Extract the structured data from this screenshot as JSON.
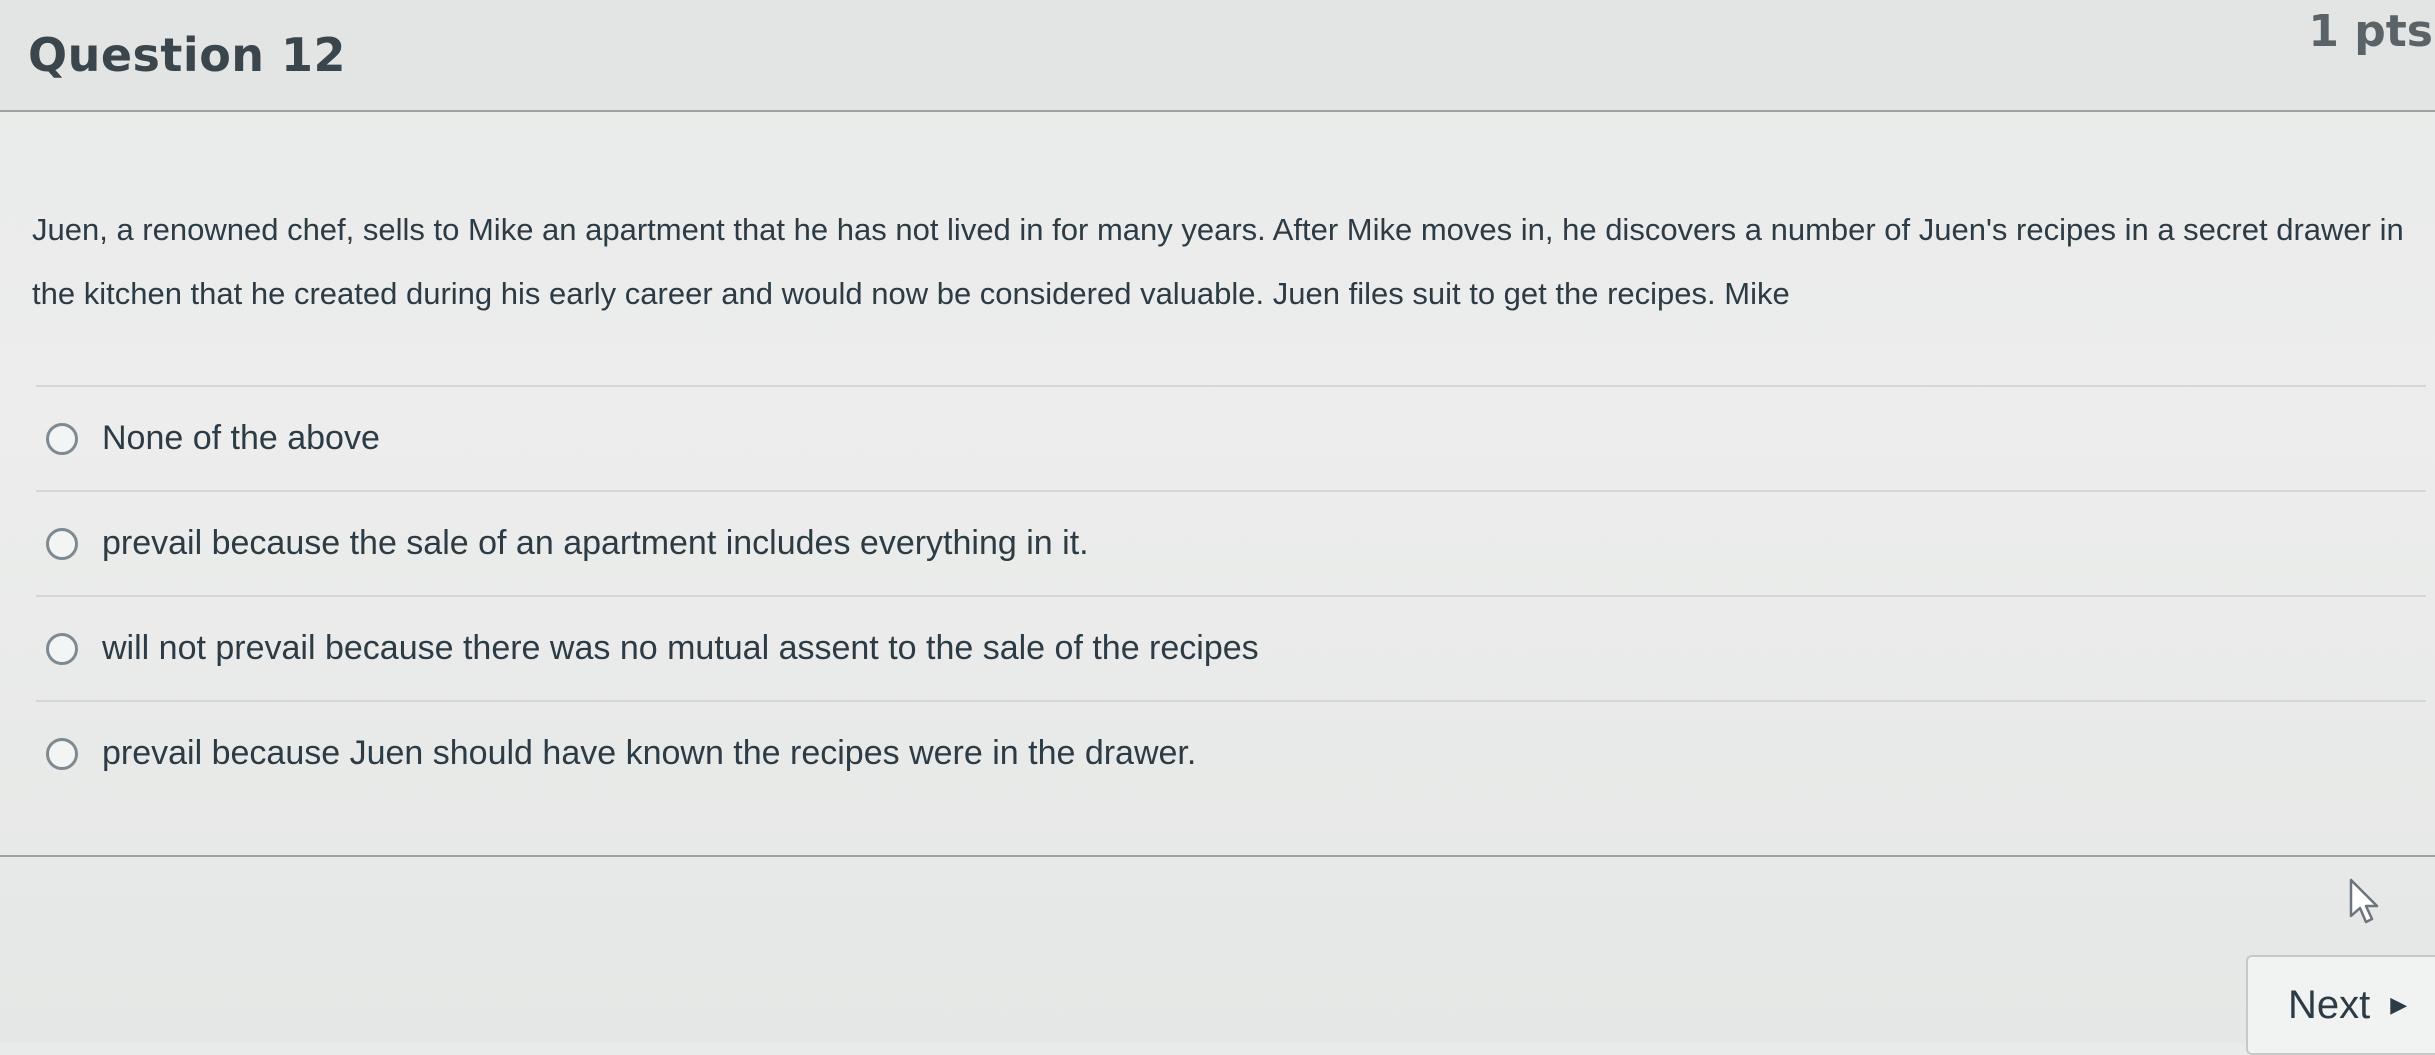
{
  "question": {
    "title": "Question 12",
    "points": "1 pts",
    "text": "Juen, a renowned chef, sells to Mike an apartment that he has not lived in for many years. After Mike moves in, he discovers a number of Juen's recipes in a secret drawer in the kitchen that he created during his early career and would now be considered valuable. Juen files suit to get the recipes. Mike",
    "answers": [
      {
        "label": "None of the above"
      },
      {
        "label": "prevail because the sale of an apartment includes everything in it."
      },
      {
        "label": "will not prevail because there was no mutual assent to the sale of the recipes"
      },
      {
        "label": "prevail because Juen should have known the recipes were in the drawer."
      }
    ]
  },
  "navigation": {
    "next_label": "Next",
    "next_icon": "triangle-right-icon"
  },
  "colors": {
    "text": "#2d3b45",
    "background": "#e9ebea",
    "divider": "#d3d7d9"
  }
}
